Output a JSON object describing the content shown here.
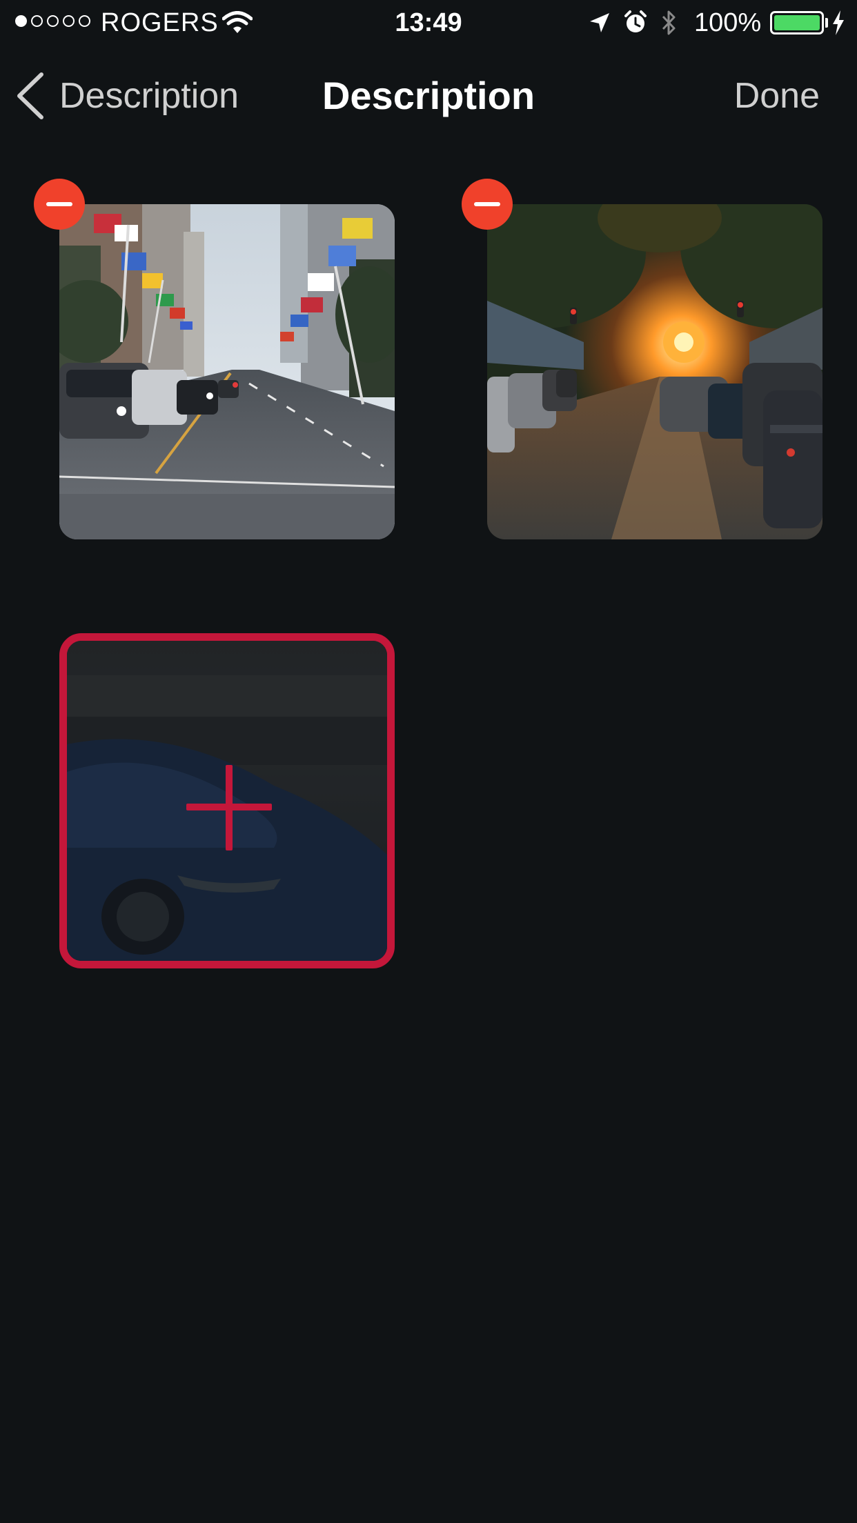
{
  "status_bar": {
    "signal_bars_filled": 1,
    "signal_bars_total": 5,
    "carrier": "ROGERS",
    "time": "13:49",
    "battery_percent": "100%",
    "battery_level": 1.0,
    "icons": [
      "wifi-icon",
      "location-arrow-icon",
      "alarm-icon",
      "bluetooth-icon",
      "battery-icon",
      "charging-bolt-icon"
    ]
  },
  "nav": {
    "back_label": "Description",
    "title": "Description",
    "done_label": "Done"
  },
  "photos": {
    "items": [
      {
        "subject": "city street lined with flags",
        "remove_icon": "minus-circle-icon"
      },
      {
        "subject": "street at sunset with parked cars",
        "remove_icon": "minus-circle-icon"
      }
    ],
    "add_tile": {
      "icon": "plus-icon",
      "background_subject": "blue car"
    }
  },
  "colors": {
    "background": "#101315",
    "remove_button": "#f0412b",
    "add_accent": "#c4173a",
    "battery_fill": "#4cd964",
    "text_secondary": "#d0d0d0"
  }
}
